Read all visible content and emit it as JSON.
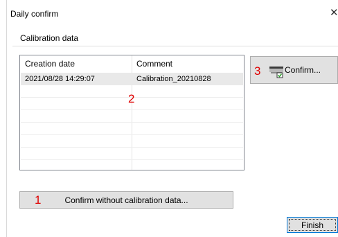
{
  "window": {
    "title": "Daily confirm",
    "close_symbol": "✕"
  },
  "section": {
    "label": "Calibration data"
  },
  "table": {
    "headers": [
      "Creation date",
      "Comment"
    ],
    "rows": [
      [
        "2021/08/28 14:29:07",
        "Calibration_20210828"
      ]
    ]
  },
  "buttons": {
    "confirm": "Confirm...",
    "confirm_without": "Confirm without calibration data...",
    "finish": "Finish"
  },
  "markers": [
    "1",
    "2",
    "3"
  ],
  "icons": {
    "confirm": "printer-check-icon"
  },
  "colors": {
    "marker": "#e00000",
    "selected_row": "#e9e9e9",
    "default_button_border": "#0078d7"
  }
}
